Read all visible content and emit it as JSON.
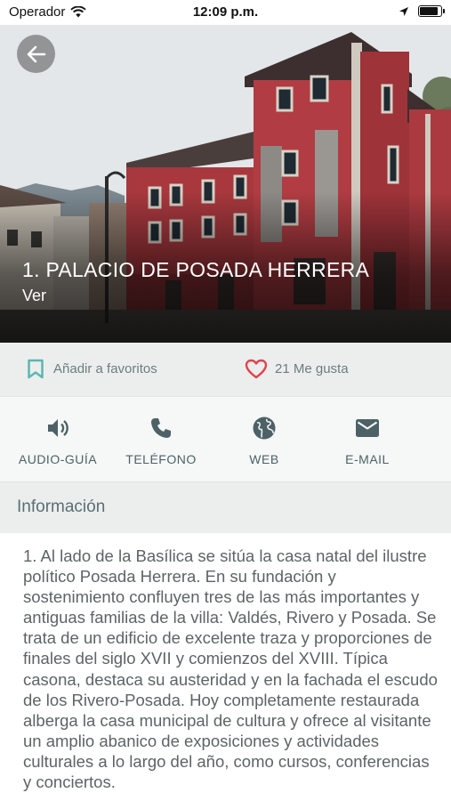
{
  "status_bar": {
    "carrier": "Operador",
    "time": "12:09 p.m."
  },
  "hero": {
    "title": "1. PALACIO DE POSADA HERRERA",
    "link": "Ver"
  },
  "actions": {
    "favorite_label": "Añadir a favoritos",
    "likes_label": "21 Me gusta"
  },
  "contacts": [
    {
      "label": "AUDIO-GUÍA",
      "icon": "speaker-icon"
    },
    {
      "label": "TELÉFONO",
      "icon": "phone-icon"
    },
    {
      "label": "WEB",
      "icon": "globe-icon"
    },
    {
      "label": "E-MAIL",
      "icon": "mail-icon"
    }
  ],
  "info": {
    "header": "Información",
    "text": "1. Al lado de la Basílica se sitúa la casa natal del ilustre político Posada Herrera. En su fundación y sostenimiento confluyen tres de las más importantes y antiguas familias de la villa: Valdés, Rivero y Posada. Se trata de un edificio de excelente traza y proporciones de finales del siglo XVII y comienzos del XVIII. Típica casona, destaca su austeridad y en la fachada el escudo de los Rivero-Posada. Hoy completamente restaurada alberga la casa municipal de cultura y ofrece al visitante un amplio abanico de exposiciones y actividades culturales a lo largo del año, como cursos, conferencias y conciertos."
  },
  "colors": {
    "accent_teal": "#5bb7b0",
    "like_red": "#e0444c",
    "icon_slate": "#4c6266",
    "building_red": "#a8383e"
  }
}
